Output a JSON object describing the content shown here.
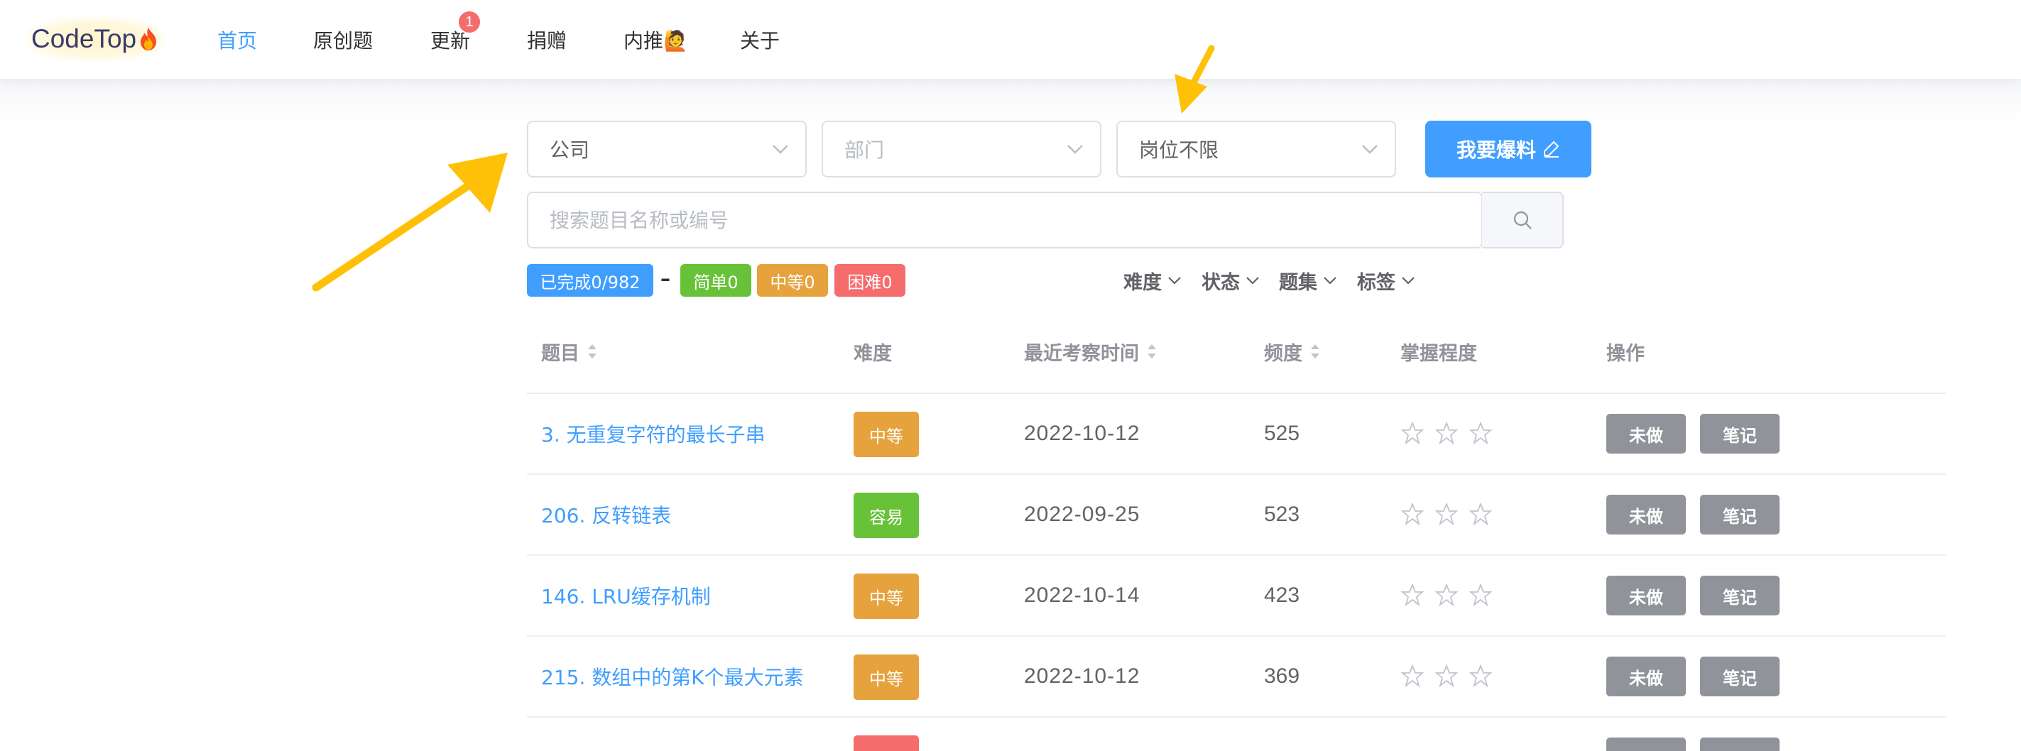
{
  "header": {
    "logo": "CodeTop",
    "nav": [
      {
        "label": "首页",
        "active": true
      },
      {
        "label": "原创题"
      },
      {
        "label": "更新",
        "badge": "1"
      },
      {
        "label": "捐赠"
      },
      {
        "label": "内推🙋"
      },
      {
        "label": "关于"
      }
    ]
  },
  "filters": {
    "company": "公司",
    "department_placeholder": "部门",
    "position": "岗位不限",
    "report_button": "我要爆料",
    "search_placeholder": "搜索题目名称或编号"
  },
  "stats": {
    "completed": "已完成0/982",
    "dash": "–",
    "easy": "简单0",
    "medium": "中等0",
    "hard": "困难0"
  },
  "filter_links": [
    "难度",
    "状态",
    "题集",
    "标签"
  ],
  "table": {
    "headers": [
      "题目",
      "难度",
      "最近考察时间",
      "频度",
      "掌握程度",
      "操作"
    ],
    "rows": [
      {
        "title": "3. 无重复字符的最长子串",
        "difficulty": "中等",
        "date": "2022-10-12",
        "freq": "525",
        "stars": 0
      },
      {
        "title": "206. 反转链表",
        "difficulty": "容易",
        "date": "2022-09-25",
        "freq": "523",
        "stars": 0
      },
      {
        "title": "146. LRU缓存机制",
        "difficulty": "中等",
        "date": "2022-10-14",
        "freq": "423",
        "stars": 0
      },
      {
        "title": "215. 数组中的第K个最大元素",
        "difficulty": "中等",
        "date": "2022-10-12",
        "freq": "369",
        "stars": 0
      }
    ],
    "todo_label": "未做",
    "note_label": "笔记"
  },
  "colors": {
    "primary": "#409eff",
    "medium": "#e6a23c",
    "easy": "#67c23a",
    "hard": "#f56c6c",
    "completed": "#409eff",
    "annotation": "#ffc107"
  }
}
